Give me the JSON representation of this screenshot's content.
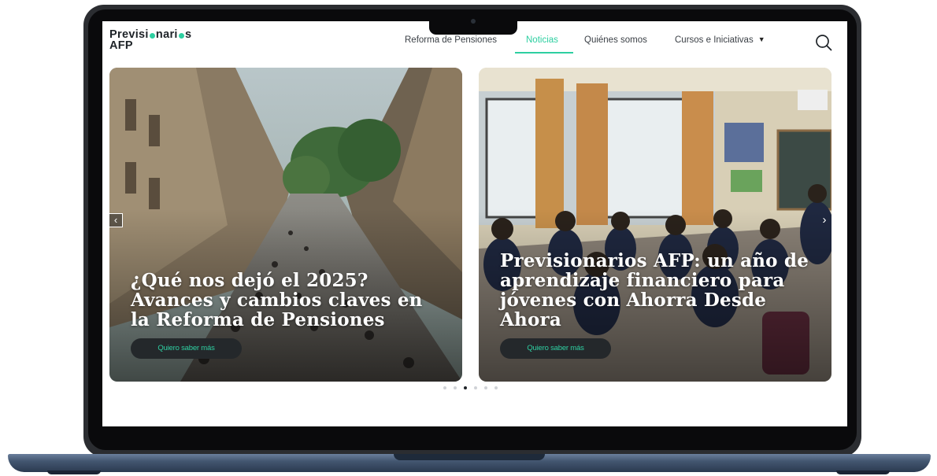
{
  "logo": {
    "line1": "Previsionarios",
    "line2": "AFP",
    "accent": "#2ecfa1"
  },
  "nav": {
    "items": [
      {
        "label": "Reforma de Pensiones"
      },
      {
        "label": "Noticias",
        "active": true
      },
      {
        "label": "Quiénes somos"
      },
      {
        "label": "Cursos e Iniciativas",
        "has_dropdown": true
      }
    ],
    "search_icon": "search-icon"
  },
  "carousel": {
    "slides": [
      {
        "title": "¿Qué nos dejó el 2025? Avances y cambios claves en la Reforma de Pensiones",
        "cta": "Quiero saber más"
      },
      {
        "title": "Previsionarios AFP: un año de aprendizaje financiero para jóvenes con Ahorra Desde Ahora",
        "cta": "Quiero saber más"
      }
    ],
    "prev_icon": "chevron-left-icon",
    "next_icon": "chevron-right-icon",
    "dot_count": 6,
    "active_dot": 3
  },
  "colors": {
    "accent": "#2ecfa1",
    "text": "#1e2328",
    "button_bg": "#24282b"
  }
}
